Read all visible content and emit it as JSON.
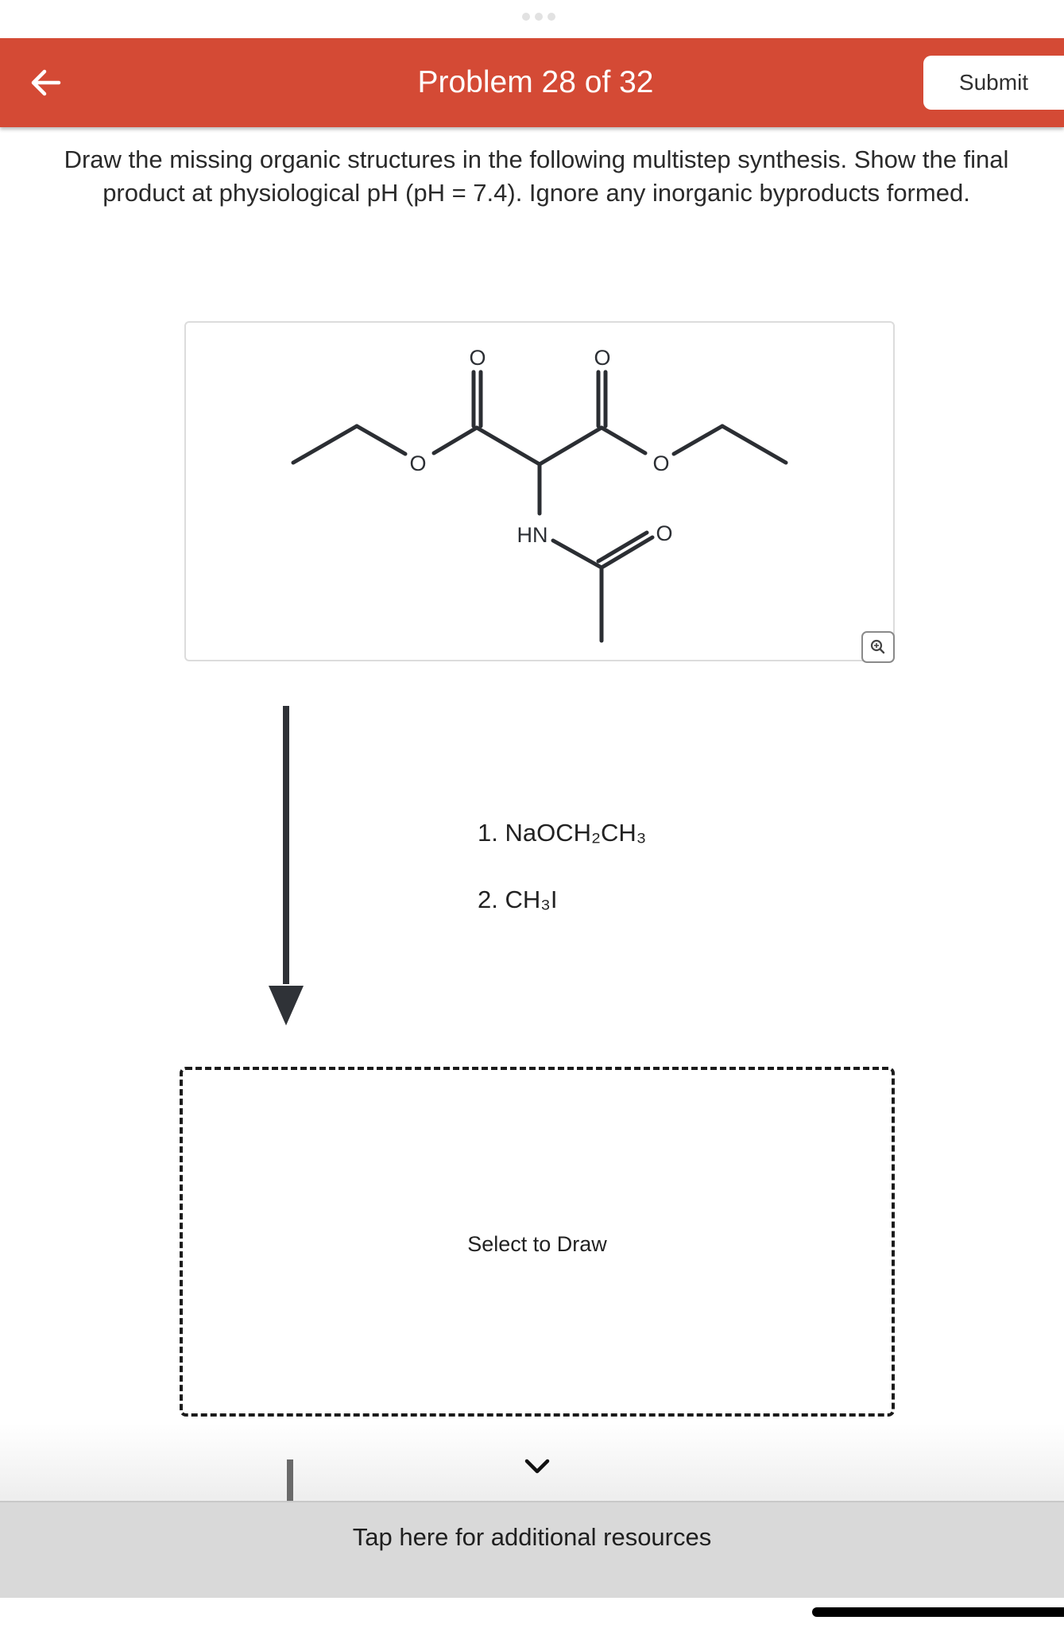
{
  "header": {
    "title": "Problem 28 of 32",
    "submit_label": "Submit"
  },
  "instructions": "Draw the missing organic structures in the following multistep synthesis. Show the final product at physiological pH (pH = 7.4). Ignore any inorganic byproducts formed.",
  "molecule": {
    "atoms": [
      "O",
      "O",
      "O",
      "O",
      "HN",
      "O"
    ]
  },
  "reagents": {
    "step1": "1. NaOCH₂CH₃",
    "step2": "2. CH₃I"
  },
  "draw_area": {
    "label": "Select to Draw"
  },
  "resources": {
    "label": "Tap here for additional resources"
  },
  "colors": {
    "header": "#d44a35",
    "resources_bar": "#d9d9d9"
  },
  "icons": {
    "back": "back-arrow-icon",
    "zoom": "magnify-icon",
    "expand": "chevron-down-icon"
  }
}
